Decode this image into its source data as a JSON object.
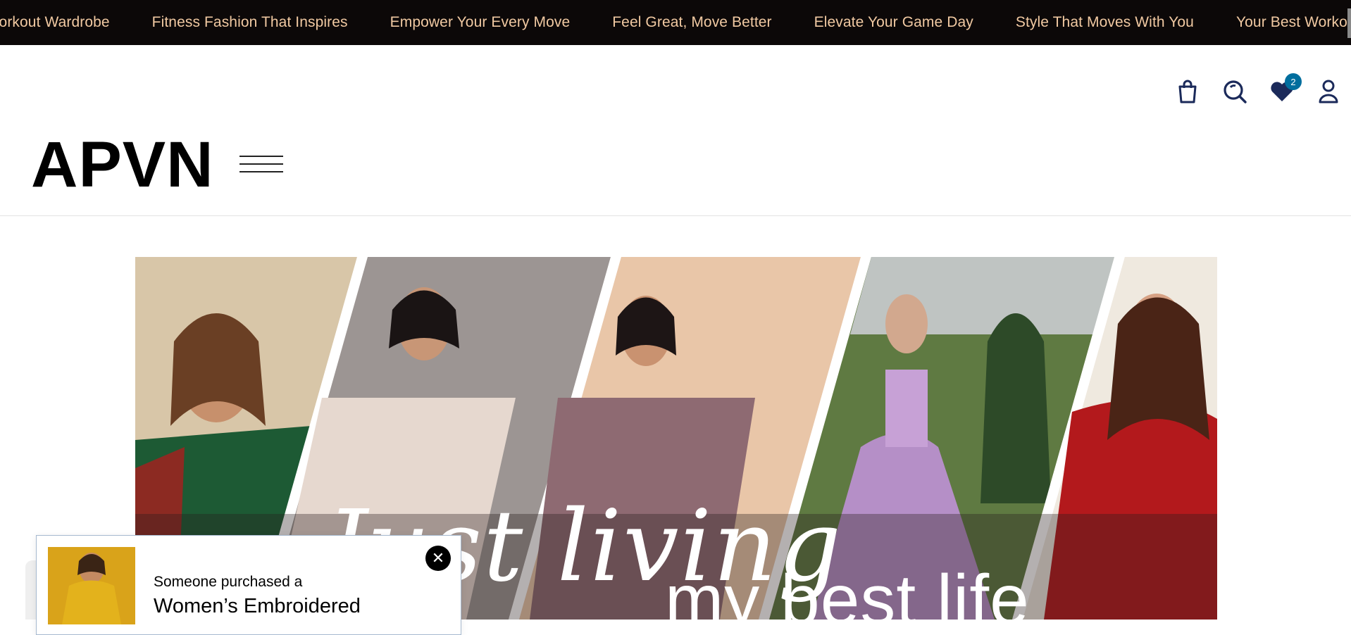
{
  "ticker": {
    "items": [
      "Workout Wardrobe",
      "Fitness Fashion That Inspires",
      "Empower Your Every Move",
      "Feel Great, Move Better",
      "Elevate Your Game Day",
      "Style That Moves With You",
      "Your Best Workout S"
    ]
  },
  "header": {
    "logo_text": "APVN",
    "icons": [
      "shopping-bag-icon",
      "search-icon",
      "heart-icon",
      "user-icon"
    ],
    "wishlist_count": "2"
  },
  "hero": {
    "overlay_script": "Just living",
    "overlay_line2": "my best life"
  },
  "popup": {
    "line1": "Someone purchased a",
    "product": "Women’s Embroidered",
    "close_symbol": "✕"
  },
  "colors": {
    "ticker_bg": "#0c0808",
    "ticker_text": "#f1c9a2",
    "icon_color": "#1b2a5a",
    "badge_bg": "#006e9e"
  }
}
